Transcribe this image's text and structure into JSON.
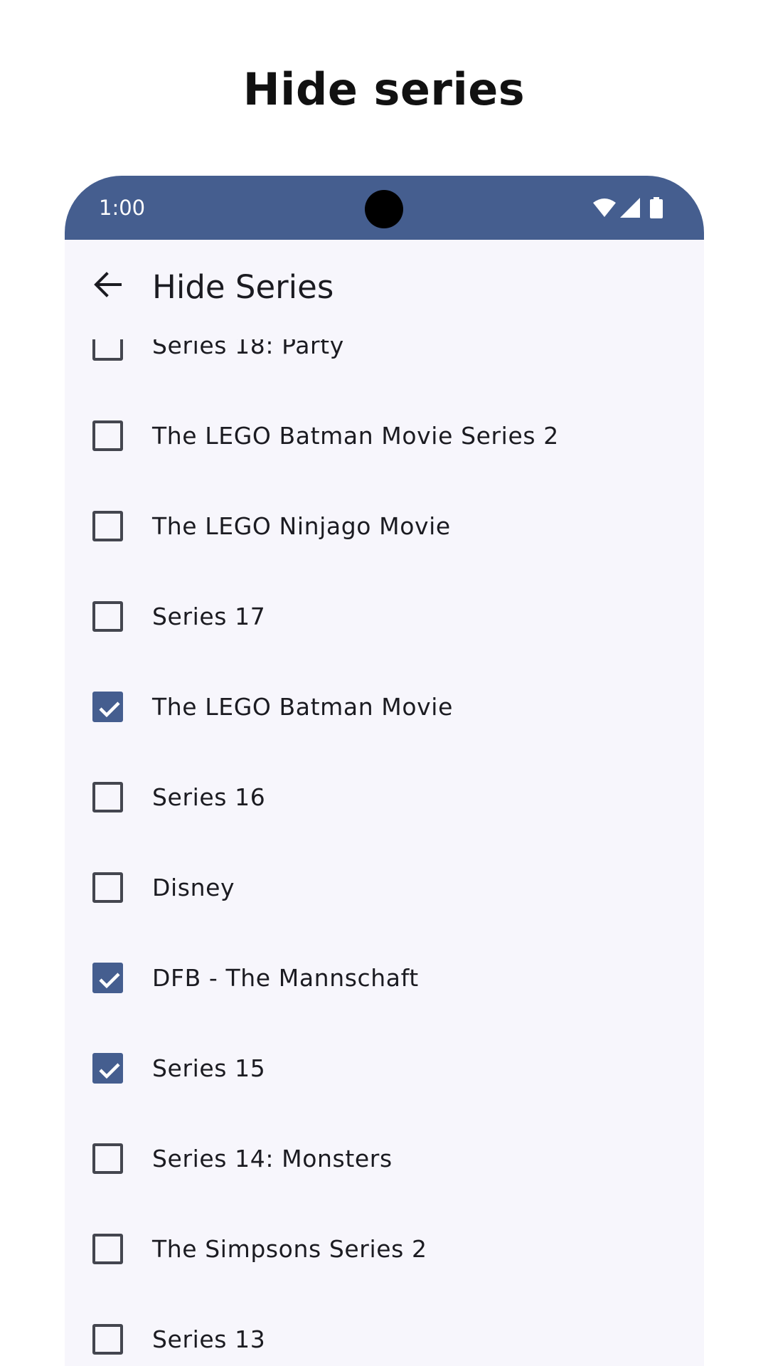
{
  "headline": "Hide series",
  "status_bar": {
    "time": "1:00",
    "icons": [
      "wifi-icon",
      "cell-signal-icon",
      "battery-icon"
    ],
    "color": "#455e8f"
  },
  "app_bar": {
    "back_icon": "arrow-back-icon",
    "title": "Hide Series"
  },
  "colors": {
    "accent": "#455e8f",
    "surface": "#f7f6fc",
    "on_surface": "#1b1b21",
    "outline": "#44464f"
  },
  "series_list": [
    {
      "label": "Series 18: Party",
      "checked": false
    },
    {
      "label": "The LEGO Batman Movie Series 2",
      "checked": false
    },
    {
      "label": "The LEGO Ninjago Movie",
      "checked": false
    },
    {
      "label": "Series 17",
      "checked": false
    },
    {
      "label": "The LEGO Batman Movie",
      "checked": true
    },
    {
      "label": "Series 16",
      "checked": false
    },
    {
      "label": "Disney",
      "checked": false
    },
    {
      "label": "DFB - The Mannschaft",
      "checked": true
    },
    {
      "label": "Series 15",
      "checked": true
    },
    {
      "label": "Series 14: Monsters",
      "checked": false
    },
    {
      "label": "The Simpsons Series 2",
      "checked": false
    },
    {
      "label": "Series 13",
      "checked": false
    }
  ]
}
